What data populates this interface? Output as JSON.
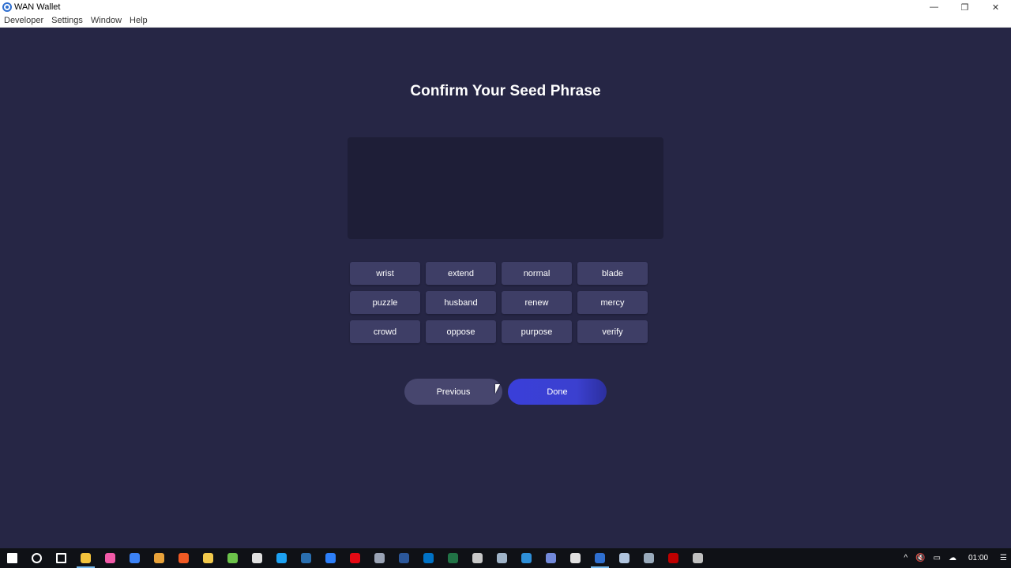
{
  "window": {
    "title": "WAN Wallet",
    "minimize_label": "—",
    "restore_label": "❐",
    "close_label": "✕"
  },
  "menu": [
    "Developer",
    "Settings",
    "Window",
    "Help"
  ],
  "page": {
    "title": "Confirm Your Seed Phrase",
    "words": [
      "wrist",
      "extend",
      "normal",
      "blade",
      "puzzle",
      "husband",
      "renew",
      "mercy",
      "crowd",
      "oppose",
      "purpose",
      "verify"
    ],
    "previous_label": "Previous",
    "done_label": "Done"
  },
  "colors": {
    "background": "#262645",
    "seed_box": "#1e1e37",
    "word_button": "#3e3e66",
    "done_button": "#3a3fd9"
  },
  "taskbar": {
    "icons": [
      {
        "name": "start-icon",
        "color": "#ffffff"
      },
      {
        "name": "search-icon",
        "color": "#ffffff"
      },
      {
        "name": "task-view-icon",
        "color": "#ffffff"
      },
      {
        "name": "file-explorer-icon",
        "color": "#f3c33c"
      },
      {
        "name": "itunes-icon",
        "color": "#f25aa8"
      },
      {
        "name": "app-blue-icon",
        "color": "#3b82f6"
      },
      {
        "name": "app-orange-icon",
        "color": "#e8a23a"
      },
      {
        "name": "brave-icon",
        "color": "#f15a24"
      },
      {
        "name": "chrome-icon",
        "color": "#f2c94c"
      },
      {
        "name": "app-green-icon",
        "color": "#6cc24a"
      },
      {
        "name": "app-color-icon",
        "color": "#e0e0e0"
      },
      {
        "name": "twitter-icon",
        "color": "#1da1f2"
      },
      {
        "name": "steam-icon",
        "color": "#2a6fb0"
      },
      {
        "name": "app-circle-icon",
        "color": "#2d7ff9"
      },
      {
        "name": "netflix-icon",
        "color": "#e50914"
      },
      {
        "name": "app-dark-icon",
        "color": "#9aa3b5"
      },
      {
        "name": "word-icon",
        "color": "#2b579a"
      },
      {
        "name": "outlook-icon",
        "color": "#0072c6"
      },
      {
        "name": "excel-icon",
        "color": "#217346"
      },
      {
        "name": "app-image-icon",
        "color": "#c8c8c8"
      },
      {
        "name": "app-bird-icon",
        "color": "#9fb3c8"
      },
      {
        "name": "vs-code-icon",
        "color": "#2e8fd8"
      },
      {
        "name": "discord-icon",
        "color": "#7289da"
      },
      {
        "name": "store-icon",
        "color": "#e0e0e0"
      },
      {
        "name": "wan-wallet-icon",
        "color": "#2f6fd0"
      },
      {
        "name": "app-network-icon",
        "color": "#b0c4de"
      },
      {
        "name": "app-windows-icon",
        "color": "#9ab"
      },
      {
        "name": "filezilla-icon",
        "color": "#bf0000"
      },
      {
        "name": "app-clock-icon",
        "color": "#c0c0c0"
      }
    ],
    "tray": {
      "chevron": "^",
      "volume": "🔇",
      "battery": "▭",
      "cloud": "☁",
      "time": "01:00",
      "notifications": "☰"
    }
  }
}
